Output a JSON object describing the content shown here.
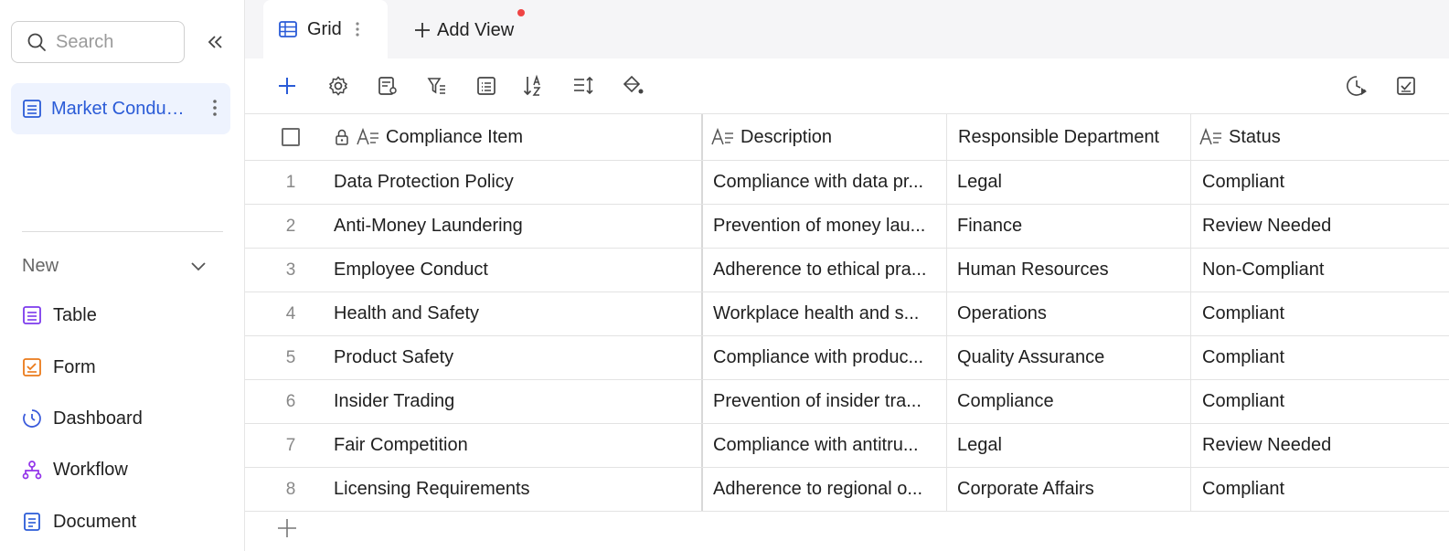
{
  "sidebar": {
    "search_placeholder": "Search",
    "active_item_label": "Market Conduct Compliance",
    "new_label": "New",
    "items": [
      {
        "label": "Table",
        "icon": "table-icon",
        "color": "#7c3aed"
      },
      {
        "label": "Form",
        "icon": "form-icon",
        "color": "#ea7a1a"
      },
      {
        "label": "Dashboard",
        "icon": "dashboard-icon",
        "color": "#3b5bdb"
      },
      {
        "label": "Workflow",
        "icon": "workflow-icon",
        "color": "#9333ea"
      },
      {
        "label": "Document",
        "icon": "document-icon",
        "color": "#2a5bd7"
      }
    ]
  },
  "tabs": {
    "grid_label": "Grid",
    "add_view_label": "Add View"
  },
  "table": {
    "columns": [
      "Compliance Item",
      "Description",
      "Responsible Department",
      "Status"
    ],
    "rows": [
      {
        "num": "1",
        "item": "Data Protection Policy",
        "description": "Compliance with data pr...",
        "department": "Legal",
        "status": "Compliant"
      },
      {
        "num": "2",
        "item": "Anti-Money Laundering",
        "description": "Prevention of money lau...",
        "department": "Finance",
        "status": "Review Needed"
      },
      {
        "num": "3",
        "item": "Employee Conduct",
        "description": "Adherence to ethical pra...",
        "department": "Human Resources",
        "status": "Non-Compliant"
      },
      {
        "num": "4",
        "item": "Health and Safety",
        "description": "Workplace health and s...",
        "department": "Operations",
        "status": "Compliant"
      },
      {
        "num": "5",
        "item": "Product Safety",
        "description": "Compliance with produc...",
        "department": "Quality Assurance",
        "status": "Compliant"
      },
      {
        "num": "6",
        "item": "Insider Trading",
        "description": "Prevention of insider tra...",
        "department": "Compliance",
        "status": "Compliant"
      },
      {
        "num": "7",
        "item": "Fair Competition",
        "description": "Compliance with antitru...",
        "department": "Legal",
        "status": "Review Needed"
      },
      {
        "num": "8",
        "item": "Licensing Requirements",
        "description": "Adherence to regional o...",
        "department": "Corporate Affairs",
        "status": "Compliant"
      }
    ]
  },
  "colors": {
    "accent": "#2a5bd7",
    "active_bg": "#eef3fe",
    "notification": "#ef4444"
  }
}
